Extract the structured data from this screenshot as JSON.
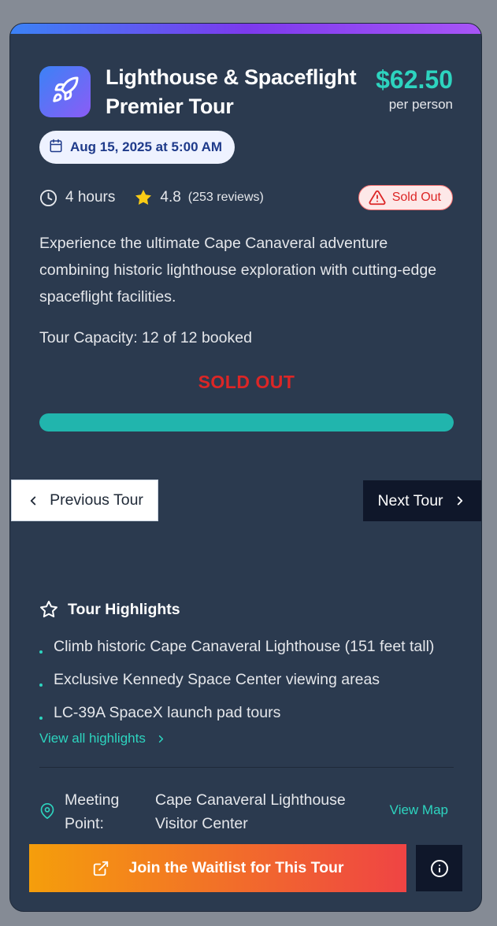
{
  "tour": {
    "title": "Lighthouse & Spaceflight Premier Tour",
    "price": "$62.50",
    "price_unit": "per person",
    "date": "Aug 15, 2025 at 5:00 AM",
    "duration": "4 hours",
    "rating": "4.8",
    "reviews": "(253 reviews)",
    "status_badge": "Sold Out",
    "description": "Experience the ultimate Cape Canaveral adventure combining historic lighthouse exploration with cutting-edge spaceflight facilities.",
    "capacity_text": "Tour Capacity: 12 of 12 booked",
    "capacity_fraction": 1.0,
    "sold_out_label": "SOLD OUT"
  },
  "nav": {
    "prev_label": "Previous Tour",
    "next_label": "Next Tour"
  },
  "highlights": {
    "heading": "Tour Highlights",
    "items": [
      "Climb historic Cape Canaveral Lighthouse (151 feet tall)",
      "Exclusive Kennedy Space Center viewing areas",
      "LC-39A SpaceX launch pad tours"
    ],
    "view_all_label": "View all highlights"
  },
  "meeting": {
    "label": "Meeting Point:",
    "value": "Cape Canaveral Lighthouse Visitor Center",
    "map_link": "View Map"
  },
  "actions": {
    "waitlist_label": "Join the Waitlist for This Tour"
  },
  "colors": {
    "accent": "#2dd4bf",
    "sold_out": "#dc2626",
    "card_bg": "#2b3a4f",
    "progress_fill": "#21b5ad"
  },
  "icons": [
    "rocket-icon",
    "calendar-icon",
    "clock-icon",
    "star-icon",
    "warning-icon",
    "chevron-left-icon",
    "chevron-right-icon",
    "star-outline-icon",
    "map-pin-icon",
    "external-link-icon",
    "info-icon"
  ]
}
